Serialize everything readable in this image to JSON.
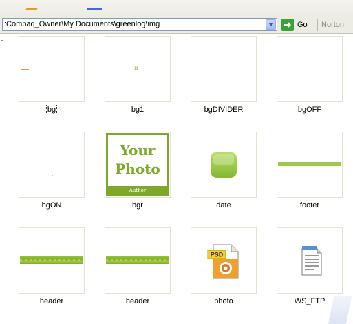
{
  "address_bar": {
    "path": ":Compaq_Owner\\My Documents\\greenlog\\img",
    "go_label": "Go",
    "norton_label": "Norton"
  },
  "items": [
    {
      "name": "bg",
      "type": "image",
      "focused": true
    },
    {
      "name": "bg1",
      "type": "image"
    },
    {
      "name": "bgDIVIDER",
      "type": "image"
    },
    {
      "name": "bgOFF",
      "type": "image"
    },
    {
      "name": "bgON",
      "type": "image"
    },
    {
      "name": "bgr",
      "type": "image",
      "preview_text": [
        "Your",
        "Photo",
        "Author"
      ]
    },
    {
      "name": "date",
      "type": "image"
    },
    {
      "name": "footer",
      "type": "image"
    },
    {
      "name": "header",
      "type": "image"
    },
    {
      "name": "header",
      "type": "image"
    },
    {
      "name": "photo",
      "type": "psd-file",
      "icon": "psd-file-icon",
      "badge": "PSD"
    },
    {
      "name": "WS_FTP",
      "type": "text-file",
      "icon": "notepad-file-icon"
    }
  ],
  "colors": {
    "accent_green": "#9cc94a",
    "dark_green": "#7da82a",
    "go_green": "#3aa335"
  }
}
